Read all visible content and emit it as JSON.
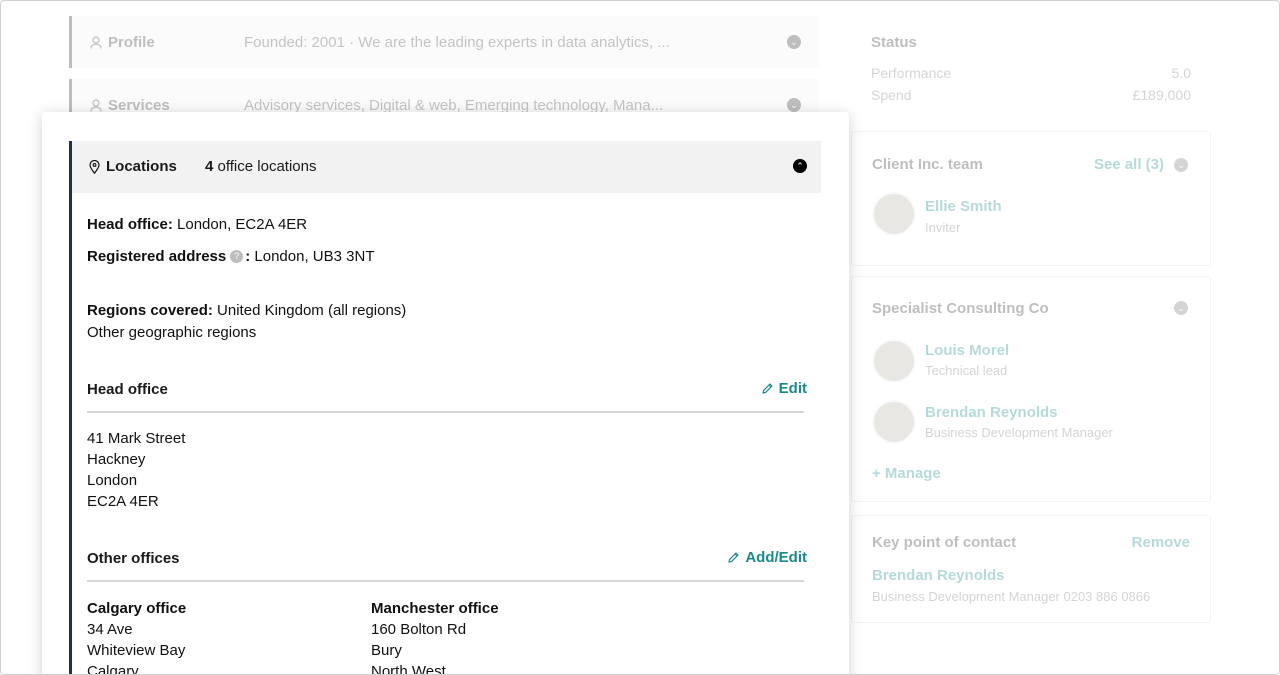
{
  "background": {
    "profile": {
      "label": "Profile",
      "summary": "Founded: 2001 · We are the leading experts in data analytics, ..."
    },
    "services": {
      "label": "Services",
      "summary": "Advisory services, Digital & web, Emerging technology, Mana..."
    },
    "status": {
      "title": "Status",
      "rows": [
        {
          "label": "Performance",
          "value": "5.0"
        },
        {
          "label": "Spend",
          "value": "£189,000"
        }
      ]
    },
    "client_team": {
      "title": "Client Inc. team",
      "see_all": "See all (3)",
      "members": [
        {
          "name": "Ellie Smith",
          "role": "Inviter"
        }
      ]
    },
    "specialist": {
      "title": "Specialist Consulting Co",
      "members": [
        {
          "name": "Louis Morel",
          "role": "Technical lead"
        },
        {
          "name": "Brendan Reynolds",
          "role": "Business Development Manager"
        }
      ],
      "manage": "+ Manage"
    },
    "key_contact": {
      "title": "Key point of contact",
      "remove": "Remove",
      "name": "Brendan Reynolds",
      "details": "Business Development Manager 0203 886 0866"
    }
  },
  "locations": {
    "label": "Locations",
    "count_number": "4",
    "count_text": "office locations",
    "head_office_label": "Head office:",
    "head_office_value": "London, EC2A 4ER",
    "registered_label": "Registered address",
    "registered_value": "London, UB3 3NT",
    "regions_label": "Regions covered:",
    "regions_value": "United Kingdom (all regions)",
    "regions_other": "Other geographic regions",
    "head_section": {
      "title": "Head office",
      "action": "Edit",
      "address": [
        "41 Mark Street",
        "Hackney",
        "London",
        "EC2A 4ER"
      ]
    },
    "other_section": {
      "title": "Other offices",
      "action": "Add/Edit",
      "offices": [
        {
          "name": "Calgary office",
          "lines": [
            "34 Ave",
            "Whiteview Bay",
            "Calgary"
          ]
        },
        {
          "name": "Manchester office",
          "lines": [
            "160 Bolton Rd",
            "Bury",
            "North West"
          ]
        }
      ]
    }
  }
}
